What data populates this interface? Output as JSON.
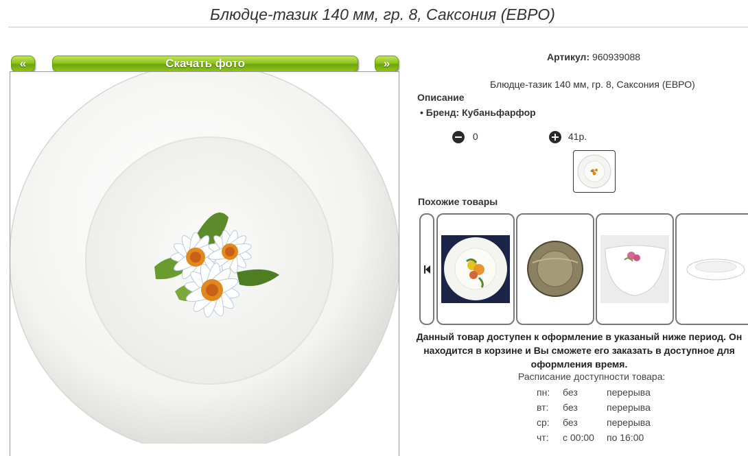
{
  "page": {
    "title": "Блюдце-тазик 140 мм, гр. 8, Саксония (ЕВРО)"
  },
  "gallery": {
    "prev_label": "«",
    "download_label": "Скачать фото",
    "next_label": "»"
  },
  "product": {
    "sku_label": "Артикул:",
    "sku_value": "960939088",
    "name": "Блюдце-тазик 140 мм, гр. 8, Саксония (ЕВРО)",
    "description_heading": "Описание",
    "brand": "Бренд: Кубаньфарфор",
    "cart": {
      "minus_icon": "minus-circle-icon",
      "quantity": "0",
      "plus_icon": "plus-circle-icon",
      "price": "41р."
    }
  },
  "similar": {
    "heading": "Похожие товары",
    "scroll_icon": "skip-back-icon",
    "items": [
      {
        "icon": "flower-plate-image"
      },
      {
        "icon": "smoked-glass-plate-image"
      },
      {
        "icon": "rose-salad-bowl-image"
      },
      {
        "icon": "white-plate-image"
      }
    ]
  },
  "availability": {
    "notice": "Данный товар доступен к оформление в указаный ниже период. Он находится в корзине и Вы сможете его заказать в доступное для оформления время.",
    "schedule_title": "Расписание доступности товара:",
    "rows": [
      {
        "day": "пн:",
        "from": "без",
        "to": "перерыва"
      },
      {
        "day": "вт:",
        "from": "без",
        "to": "перерыва"
      },
      {
        "day": "ср:",
        "from": "без",
        "to": "перерыва"
      },
      {
        "day": "чт:",
        "from": "с 00:00",
        "to": "по 16:00"
      }
    ]
  },
  "colors": {
    "button_green": "#8fc41d",
    "border": "#777777"
  }
}
